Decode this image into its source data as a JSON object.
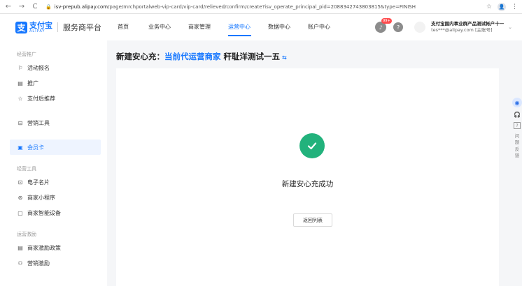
{
  "browser": {
    "back": "←",
    "forward": "→",
    "reload": "C",
    "lock": "🔒",
    "url_host": "isv-prepub.alipay.com",
    "url_path": "/page/mrchportalweb-vip-card/vip-card/relieved/confirm/create?isv_operate_principal_pid=2088342743803815&type=FINISH",
    "star": "☆",
    "profile": "👤",
    "menu": "⋮"
  },
  "header": {
    "logo_mark": "支",
    "logo_cn": "支付宝",
    "logo_en": "ALIPAY",
    "platform": "服务商平台",
    "nav": [
      {
        "label": "首页"
      },
      {
        "label": "业务中心"
      },
      {
        "label": "商家管理"
      },
      {
        "label": "运营中心"
      },
      {
        "label": "数据中心"
      },
      {
        "label": "账户中心"
      }
    ],
    "active_nav": "运营中心",
    "notification_badge": "99+",
    "help": "?",
    "account_name": "支付宝国内事业群产品测试帐户十一",
    "account_email": "tes***@alipay.com [主账号]",
    "account_chevron": "⌄"
  },
  "sidebar": {
    "groups": [
      {
        "title": "经营推广",
        "items": [
          {
            "icon": "⚐",
            "label": "活动报名"
          },
          {
            "icon": "▤",
            "label": "推广"
          },
          {
            "icon": "☆",
            "label": "支付后推荐"
          }
        ]
      },
      {
        "title": "",
        "items": [
          {
            "icon": "⊟",
            "label": "营销工具"
          }
        ]
      },
      {
        "title": "",
        "items": [
          {
            "icon": "▣",
            "label": "会员卡",
            "active": true
          }
        ]
      },
      {
        "title": "经营工具",
        "items": [
          {
            "icon": "⊡",
            "label": "电子名片"
          },
          {
            "icon": "⊛",
            "label": "商家小程序"
          },
          {
            "icon": "▢",
            "label": "商家智能设备"
          }
        ]
      },
      {
        "title": "运营激励",
        "items": [
          {
            "icon": "▤",
            "label": "商家激励政策"
          },
          {
            "icon": "⚇",
            "label": "营销激励"
          }
        ]
      }
    ]
  },
  "main": {
    "title_prefix": "新建安心充：",
    "title_highlight": "当前代运营商家",
    "title_merchant": " 秆耻洋测试一五",
    "title_switch": "⇆",
    "success_text": "新建安心充成功",
    "back_button": "返回列表"
  },
  "float": {
    "robot": "◉",
    "headset": "🎧",
    "help": "?",
    "feedback": [
      "问",
      "题",
      "反",
      "馈"
    ]
  },
  "colors": {
    "accent": "#1677ff",
    "success": "#22b27c",
    "badge": "#ff4d4f"
  }
}
